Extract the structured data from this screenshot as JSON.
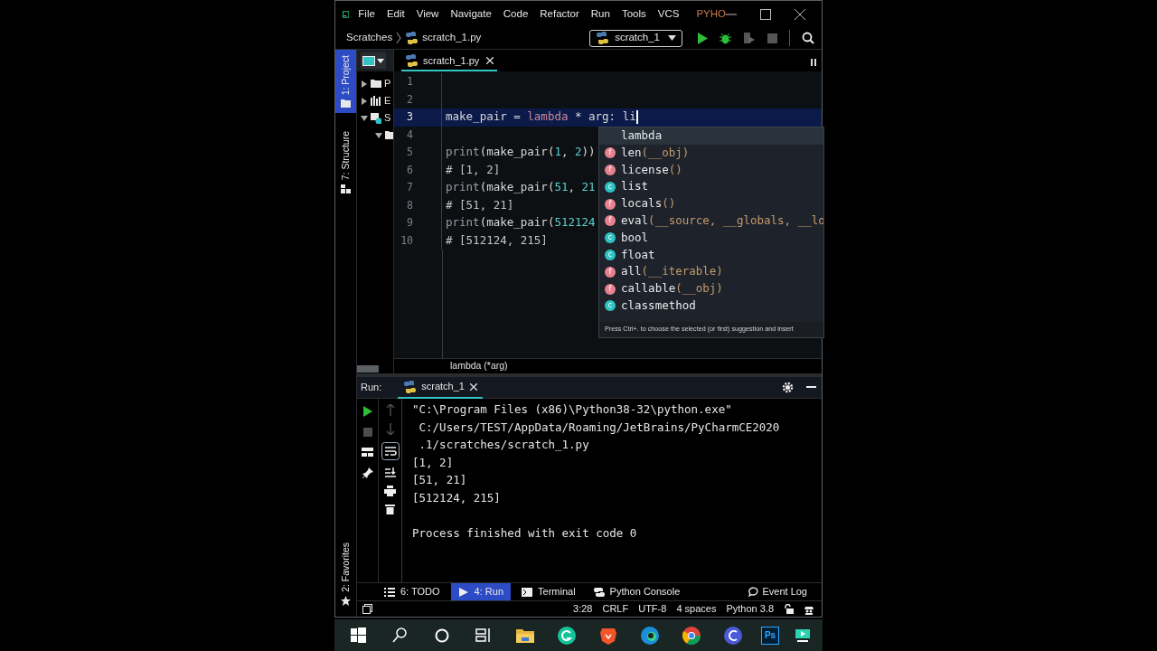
{
  "menu": [
    "File",
    "Edit",
    "View",
    "Navigate",
    "Code",
    "Refactor",
    "Run",
    "Tools",
    "VCS"
  ],
  "window_title": "PYHO",
  "breadcrumb": [
    "Scratches",
    "scratch_1.py"
  ],
  "run_config": "scratch_1",
  "side_tabs": [
    {
      "label": "1: Project",
      "selected": true
    },
    {
      "label": "7: Structure",
      "selected": false
    }
  ],
  "favorites_tab": "2: Favorites",
  "project_tree": [
    {
      "kind": "folder",
      "label": "P",
      "expanded": false
    },
    {
      "kind": "library",
      "label": "E",
      "expanded": false
    },
    {
      "kind": "scratches",
      "label": "S",
      "expanded": true,
      "children": [
        {
          "kind": "folder",
          "expanded": true
        }
      ]
    }
  ],
  "editor_tabs": [
    {
      "label": "scratch_1.py",
      "selected": true
    }
  ],
  "code_lines": [
    {
      "number": "1",
      "current": false
    },
    {
      "number": "2",
      "current": false
    },
    {
      "number": "3",
      "current": true,
      "tokens": [
        {
          "kind": "plain",
          "text": "make_pair = "
        },
        {
          "kind": "keyword",
          "text": "lambda"
        },
        {
          "kind": "plain",
          "text": " * arg: li"
        }
      ]
    },
    {
      "number": "4",
      "current": false
    },
    {
      "number": "5",
      "current": false,
      "tokens": [
        {
          "kind": "builtin",
          "text": "print"
        },
        {
          "kind": "plain",
          "text": "(make_pair("
        },
        {
          "kind": "number",
          "text": "1"
        },
        {
          "kind": "plain",
          "text": ", "
        },
        {
          "kind": "number",
          "text": "2"
        },
        {
          "kind": "plain",
          "text": "))"
        }
      ]
    },
    {
      "number": "6",
      "current": false,
      "tokens": [
        {
          "kind": "comment",
          "text": "# [1, 2]"
        }
      ]
    },
    {
      "number": "7",
      "current": false,
      "tokens": [
        {
          "kind": "builtin",
          "text": "print"
        },
        {
          "kind": "plain",
          "text": "(make_pair("
        },
        {
          "kind": "number",
          "text": "51"
        },
        {
          "kind": "plain",
          "text": ", "
        },
        {
          "kind": "number",
          "text": "21"
        }
      ]
    },
    {
      "number": "8",
      "current": false,
      "tokens": [
        {
          "kind": "comment",
          "text": "# [51, 21]"
        }
      ]
    },
    {
      "number": "9",
      "current": false,
      "tokens": [
        {
          "kind": "builtin",
          "text": "print"
        },
        {
          "kind": "plain",
          "text": "(make_pair("
        },
        {
          "kind": "number",
          "text": "512124"
        }
      ]
    },
    {
      "number": "10",
      "current": false,
      "tokens": [
        {
          "kind": "comment",
          "text": "# [512124, 215]"
        }
      ]
    }
  ],
  "completion": {
    "items": [
      {
        "kind": "keyword",
        "name": "lambda",
        "selected": true
      },
      {
        "kind": "f",
        "name": "len",
        "params": "(__obj)",
        "selected": false
      },
      {
        "kind": "f",
        "name": "license",
        "params": "()",
        "selected": false
      },
      {
        "kind": "c",
        "name": "list",
        "selected": false
      },
      {
        "kind": "f",
        "name": "locals",
        "params": "()",
        "selected": false
      },
      {
        "kind": "f",
        "name": "eval",
        "params": "(__source, __globals, __lo",
        "selected": false
      },
      {
        "kind": "c",
        "name": "bool",
        "selected": false
      },
      {
        "kind": "c",
        "name": "float",
        "selected": false
      },
      {
        "kind": "f",
        "name": "all",
        "params": "(__iterable)",
        "selected": false
      },
      {
        "kind": "f",
        "name": "callable",
        "params": "(__obj)",
        "selected": false
      },
      {
        "kind": "c",
        "name": "classmethod",
        "selected": false
      }
    ],
    "hint": "Press Ctrl+. to choose the selected (or first) suggestion and insert"
  },
  "editor_breadcrumb": "lambda (*arg)",
  "run_panel": {
    "title": "Run:",
    "tab": "scratch_1",
    "output": [
      "\"C:\\Program Files (x86)\\Python38-32\\python.exe\"",
      " C:/Users/TEST/AppData/Roaming/JetBrains/PyCharmCE2020",
      " .1/scratches/scratch_1.py",
      "[1, 2]",
      "[51, 21]",
      "[512124, 215]"
    ],
    "exit_message": "Process finished with exit code 0"
  },
  "bottom_tabs": [
    {
      "kind": "list",
      "label": "6: TODO",
      "selected": false
    },
    {
      "kind": "run",
      "label": "4: Run",
      "selected": true
    },
    {
      "kind": "terminal",
      "label": "Terminal",
      "selected": false
    },
    {
      "kind": "python",
      "label": "Python Console",
      "selected": false
    }
  ],
  "event_log": "Event Log",
  "status": [
    "3:28",
    "CRLF",
    "UTF-8",
    "4 spaces",
    "Python 3.8"
  ],
  "taskbar": {
    "ps_label": "Ps"
  }
}
